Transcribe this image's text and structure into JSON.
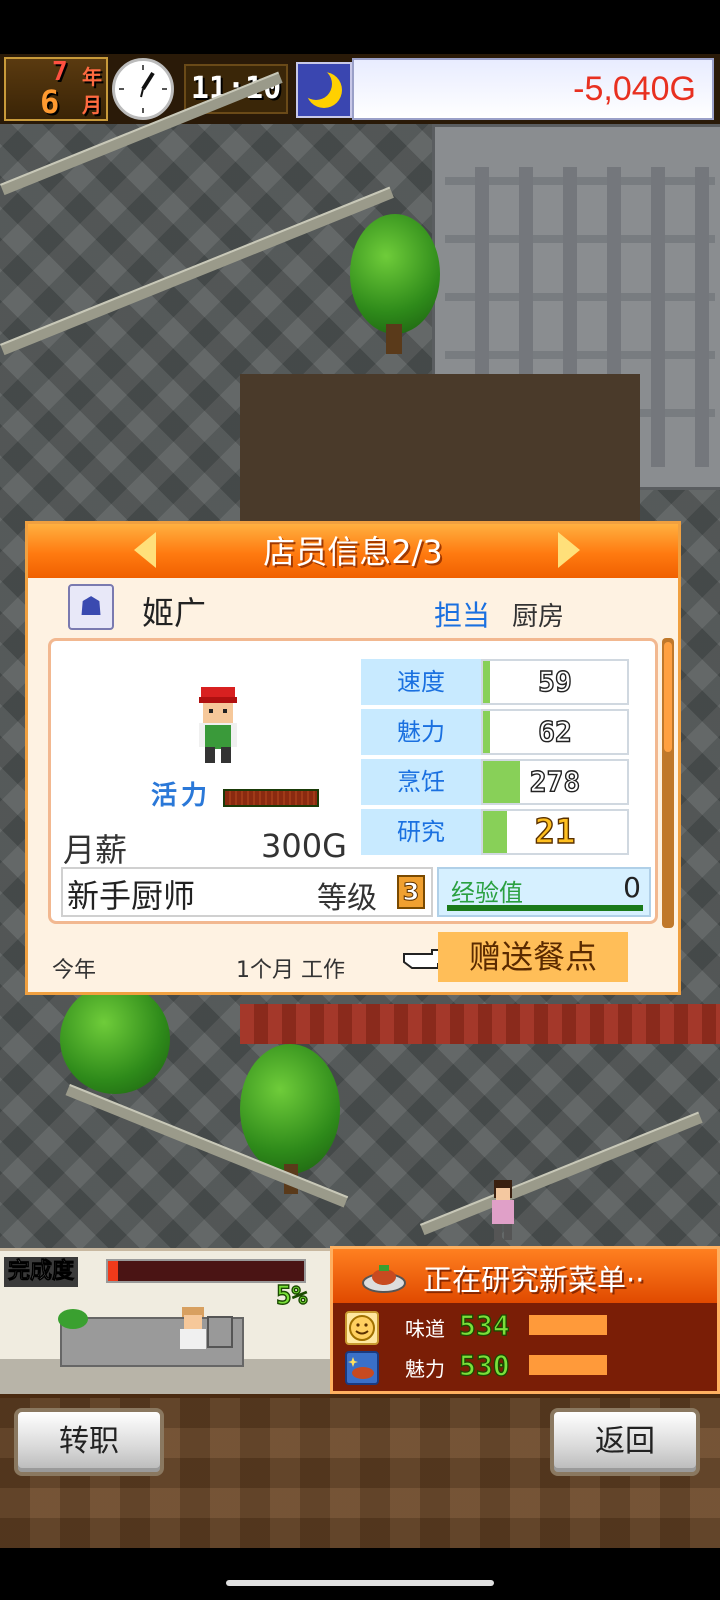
{
  "status_bar": {
    "year_num": "7",
    "year_unit": "年",
    "month_num": "6",
    "month_unit": "月",
    "time": "11:10",
    "money": "-5,040G"
  },
  "dialog": {
    "title": "店员信息2/3",
    "staff_name": "姬广",
    "role_label": "担当",
    "role_value": "厨房",
    "energy_label": "活力",
    "energy_level": 1.0,
    "salary_label": "月薪",
    "salary_value": "300G",
    "stats": [
      {
        "name": "速度",
        "value": "59",
        "fill": 0.05
      },
      {
        "name": "魅力",
        "value": "62",
        "fill": 0.05
      },
      {
        "name": "烹饪",
        "value": "278",
        "fill": 0.26
      },
      {
        "name": "研究",
        "value": "21",
        "fill": 0.17
      }
    ],
    "job_title": "新手厨师",
    "level_label": "等级",
    "level_value": "3",
    "exp_label": "经验值",
    "exp_value": "0",
    "tenure_label": "今年",
    "tenure_value": "1个月 工作",
    "gift_button": "赠送餐点"
  },
  "progress": {
    "label": "完成度",
    "percent_text": "5%",
    "percent": 0.05
  },
  "research": {
    "title": "正在研究新菜单··",
    "metrics": [
      {
        "name": "味道",
        "value": "534",
        "icon": "smiley-icon",
        "fill": 0.42
      },
      {
        "name": "魅力",
        "value": "530",
        "icon": "sparkle-dish-icon",
        "fill": 0.42
      }
    ]
  },
  "actions": {
    "transfer": "转职",
    "back": "返回"
  },
  "colors": {
    "accent_orange": "#ff7a10",
    "money_red": "#e83020",
    "stat_blue": "#1a70e0",
    "stat_fill_green": "#88d058"
  }
}
